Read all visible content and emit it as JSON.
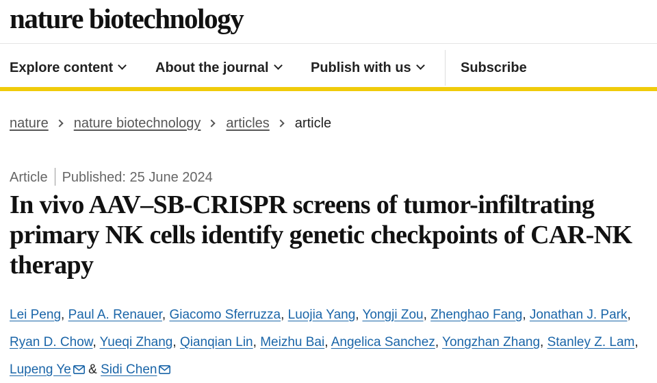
{
  "site": {
    "logo_text": "nature biotechnology"
  },
  "nav": {
    "items": [
      {
        "label": "Explore content",
        "has_chevron": true
      },
      {
        "label": "About the journal",
        "has_chevron": true
      },
      {
        "label": "Publish with us",
        "has_chevron": true
      }
    ],
    "subscribe_label": "Subscribe"
  },
  "breadcrumb": {
    "links": [
      "nature",
      "nature biotechnology",
      "articles"
    ],
    "current": "article"
  },
  "article": {
    "type": "Article",
    "published": "Published: 25 June 2024",
    "title": "In vivo AAV–SB-CRISPR screens of tumor-infiltrating primary NK cells identify genetic checkpoints of CAR-NK therapy",
    "authors": [
      "Lei Peng",
      "Paul A. Renauer",
      "Giacomo Sferruzza",
      "Luojia Yang",
      "Yongji Zou",
      "Zhenghao Fang",
      "Jonathan J. Park",
      "Ryan D. Chow",
      "Yueqi Zhang",
      "Qianqian Lin",
      "Meizhu Bai",
      "Angelica Sanchez",
      "Yongzhan Zhang",
      "Stanley Z. Lam",
      "Lupeng Ye",
      "Sidi Chen"
    ],
    "separators": {
      "comma": ",",
      "ampersand": "&"
    }
  },
  "colors": {
    "accent_yellow": "#f0cb0a",
    "link_blue": "#1a65a8"
  },
  "icons": {
    "nav_dropdown": "chevron-down-icon",
    "breadcrumb_separator": "chevron-right-icon",
    "corresponding_author": "envelope-icon"
  }
}
